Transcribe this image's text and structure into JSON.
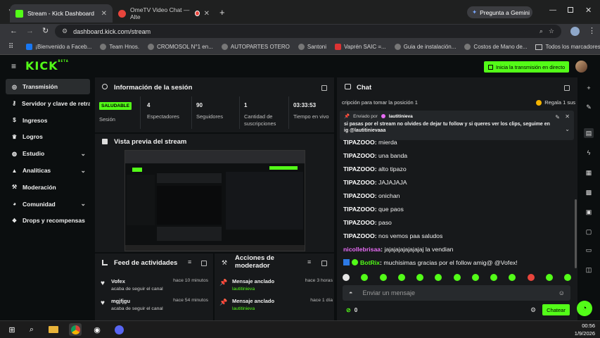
{
  "browser": {
    "tabs": [
      {
        "title": "Stream - Kick Dashboard",
        "active": true
      },
      {
        "title": "OmeTV Video Chat — Alte",
        "active": false
      }
    ],
    "gemini_label": "Pregunta a Gemini",
    "url": "dashboard.kick.com/stream",
    "bookmarks": [
      "¡Bienvenido a Faceb...",
      "Team Hnos.",
      "CROMOSOL N°1 en...",
      "AUTOPARTES OTERO",
      "Santoni",
      "Vaprén SAIC =...",
      "Guia de instalación...",
      "Costos de Mano de..."
    ],
    "all_bookmarks": "Todos los marcadores"
  },
  "kick": {
    "logo": "KICK",
    "logo_sup": "BETA",
    "start_stream": "Inicia la transmisión en directo"
  },
  "sidebar": {
    "items": [
      {
        "label": "Transmisión",
        "icon": "broadcast-icon",
        "selected": true,
        "chev": false
      },
      {
        "label": "Servidor y clave de retrans",
        "icon": "key-icon",
        "selected": false,
        "chev": false
      },
      {
        "label": "Ingresos",
        "icon": "dollar-icon",
        "selected": false,
        "chev": false
      },
      {
        "label": "Logros",
        "icon": "trophy-icon",
        "selected": false,
        "chev": false
      },
      {
        "label": "Estudio",
        "icon": "studio-icon",
        "selected": false,
        "chev": true
      },
      {
        "label": "Analíticas",
        "icon": "analytics-icon",
        "selected": false,
        "chev": true
      },
      {
        "label": "Moderación",
        "icon": "hammer-icon",
        "selected": false,
        "chev": false
      },
      {
        "label": "Comunidad",
        "icon": "community-icon",
        "selected": false,
        "chev": true
      },
      {
        "label": "Drops y recompensas",
        "icon": "gift-icon",
        "selected": false,
        "chev": false
      }
    ]
  },
  "session": {
    "title": "Información de la sesión",
    "badge": "SALUDABLE",
    "badge_label": "Sesión",
    "stats": [
      {
        "value": "4",
        "label": "Espectadores"
      },
      {
        "value": "90",
        "label": "Seguidores"
      },
      {
        "value": "1",
        "label": "Cantidad de suscripciones"
      },
      {
        "value": "03:33:53",
        "label": "Tiempo en vivo"
      }
    ]
  },
  "preview": {
    "title": "Vista previa del stream"
  },
  "feed": {
    "title": "Feed de actividades",
    "items": [
      {
        "name": "Vofex",
        "sub": "acaba de seguir el canal",
        "time": "hace 10 minutos"
      },
      {
        "name": "mgjfjgu",
        "sub": "acaba de seguir el canal",
        "time": "hace 54 minutos"
      }
    ]
  },
  "mod": {
    "title": "Acciones de moderador",
    "items": [
      {
        "name": "Mensaje anclado",
        "sub": "lautitinieva",
        "time": "hace 3 horas"
      },
      {
        "name": "Mensaje anclado",
        "sub": "lautitinieva",
        "time": "hace 1 día"
      }
    ]
  },
  "chat": {
    "title": "Chat",
    "ticker": "cripción para tomar la posición 1",
    "gift": "Regala 1 sus",
    "pinned_by": "Enviado por",
    "pinned_user": "lautitinieva",
    "pinned_text": "si pasas por el stream no olvides de dejar tu follow y si queres ver los clips, seguime en ig @lautitinievaaa",
    "messages": [
      {
        "user": "TIPAZOOO",
        "text": "mierda",
        "color": "#ffffff"
      },
      {
        "user": "TIPAZOOO",
        "text": "una banda",
        "color": "#ffffff"
      },
      {
        "user": "TIPAZOOO",
        "text": "alto tipazo",
        "color": "#ffffff"
      },
      {
        "user": "TIPAZOOO",
        "text": "JAJAJAJA",
        "color": "#ffffff"
      },
      {
        "user": "TIPAZOOO",
        "text": "onichan",
        "color": "#ffffff"
      },
      {
        "user": "TIPAZOOO",
        "text": "que paos",
        "color": "#ffffff"
      },
      {
        "user": "TIPAZOOO",
        "text": "paso",
        "color": "#ffffff"
      },
      {
        "user": "TIPAZOOO",
        "text": "nos vemos paa saludos",
        "color": "#ffffff"
      },
      {
        "user": "nicollebrisaa",
        "text": "jajajajajajajajaj la vendian",
        "color": "#e86cf5"
      },
      {
        "user": "BotRix",
        "text": "muchisimas gracias por el follow amig@ @Vofex!",
        "color": "#53fc18"
      }
    ],
    "placeholder": "Enviar un mensaje",
    "points": "0",
    "send": "Chatear"
  },
  "taskbar": {
    "time": "00:56",
    "date": "1/9/2026"
  },
  "colors": {
    "accent": "#53fc18",
    "bg": "#0b0e0f",
    "panel": "#17191b"
  }
}
